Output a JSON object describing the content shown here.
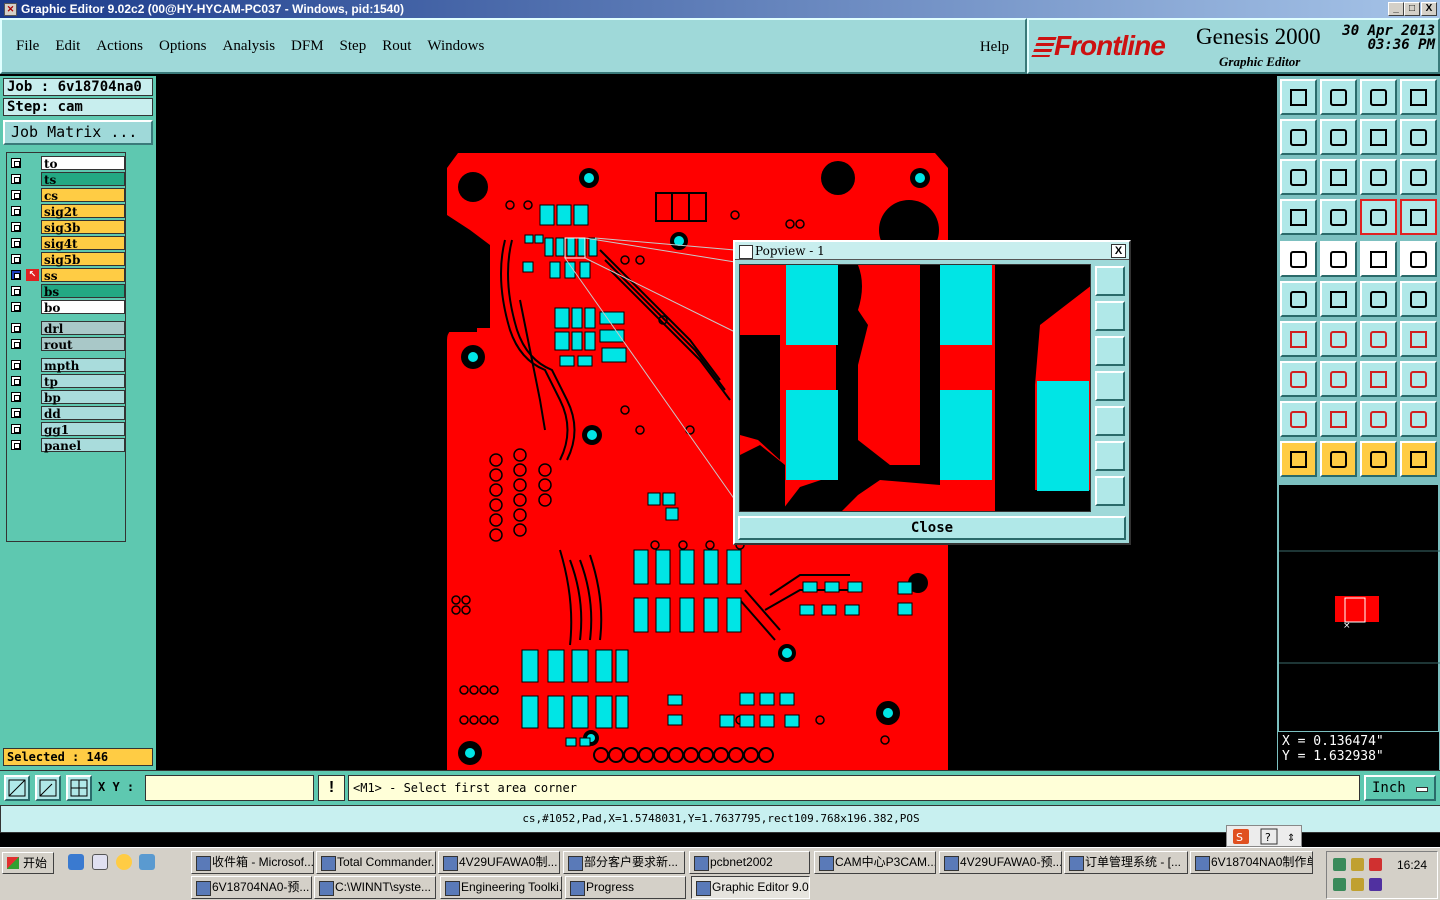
{
  "window": {
    "title": "Graphic Editor 9.02c2 (00@HY-HYCAM-PC037 - Windows, pid:1540)",
    "min": "_",
    "max": "□",
    "close": "X"
  },
  "menu": [
    "File",
    "Edit",
    "Actions",
    "Options",
    "Analysis",
    "DFM",
    "Step",
    "Rout",
    "Windows"
  ],
  "help": "Help",
  "brand": {
    "logo": "Frontline",
    "product": "Genesis 2000",
    "subtitle": "Graphic Editor",
    "date": "30 Apr 2013",
    "time": "03:36 PM"
  },
  "job": {
    "job_label": "Job : 6v18704na0",
    "step_label": "Step: cam",
    "matrix_button": "Job Matrix ..."
  },
  "layers": [
    {
      "name": "to",
      "color": "#ffffff"
    },
    {
      "name": "ts",
      "color": "#23a883"
    },
    {
      "name": "cs",
      "color": "#ffcc44"
    },
    {
      "name": "sig2t",
      "color": "#ffcc44"
    },
    {
      "name": "sig3b",
      "color": "#ffcc44"
    },
    {
      "name": "sig4t",
      "color": "#ffcc44"
    },
    {
      "name": "sig5b",
      "color": "#ffcc44"
    },
    {
      "name": "ss",
      "color": "#ffcc44"
    },
    {
      "name": "bs",
      "color": "#23a883"
    },
    {
      "name": "bo",
      "color": "#ffffff"
    },
    {
      "name": "drl",
      "color": "#a9c8c8"
    },
    {
      "name": "rout",
      "color": "#a9c8c8"
    },
    {
      "name": "mpth",
      "color": "#a9dcdc"
    },
    {
      "name": "tp",
      "color": "#a9dcdc"
    },
    {
      "name": "bp",
      "color": "#a9dcdc"
    },
    {
      "name": "dd",
      "color": "#a9dcdc"
    },
    {
      "name": "gg1",
      "color": "#a9dcdc"
    },
    {
      "name": "panel",
      "color": "#a9dcdc"
    }
  ],
  "selected": "Selected : 146",
  "coords": {
    "x": "X = 0.136474\"",
    "y": "Y = 1.632938\""
  },
  "cmd": {
    "xy_label": "X Y :",
    "xy_value": "",
    "excl": "!",
    "prompt": "<M1> - Select first area corner",
    "unit": "Inch"
  },
  "status": "cs,#1052,Pad,X=1.5748031,Y=1.7637795,rect109.768x196.382,POS",
  "popview": {
    "title": "Popview - 1",
    "close_x": "X",
    "close_button": "Close"
  },
  "taskbar": {
    "start": "开始",
    "row1": [
      "收件箱 - Microsof...",
      "Total Commander...",
      "4V29UFAWA0制...",
      "部分客户要求新...",
      "pcbnet2002",
      "CAM中心P3CAM...",
      "4V29UFAWA0-预...",
      "订单管理系统 - [...",
      "6V18704NA0制作单"
    ],
    "row2": [
      "6V18704NA0-预...",
      "C:\\WINNT\\syste...",
      "Engineering Toolki...",
      "Progress",
      "Graphic Editor 9.0..."
    ],
    "clock": "16:24"
  },
  "colors": {
    "board": "#ff0000",
    "pad": "#00e5e5",
    "trace_gap": "#000000",
    "panel": "#5ec8b0",
    "menu": "#9fd9d9",
    "highlight": "#ffcc44"
  }
}
